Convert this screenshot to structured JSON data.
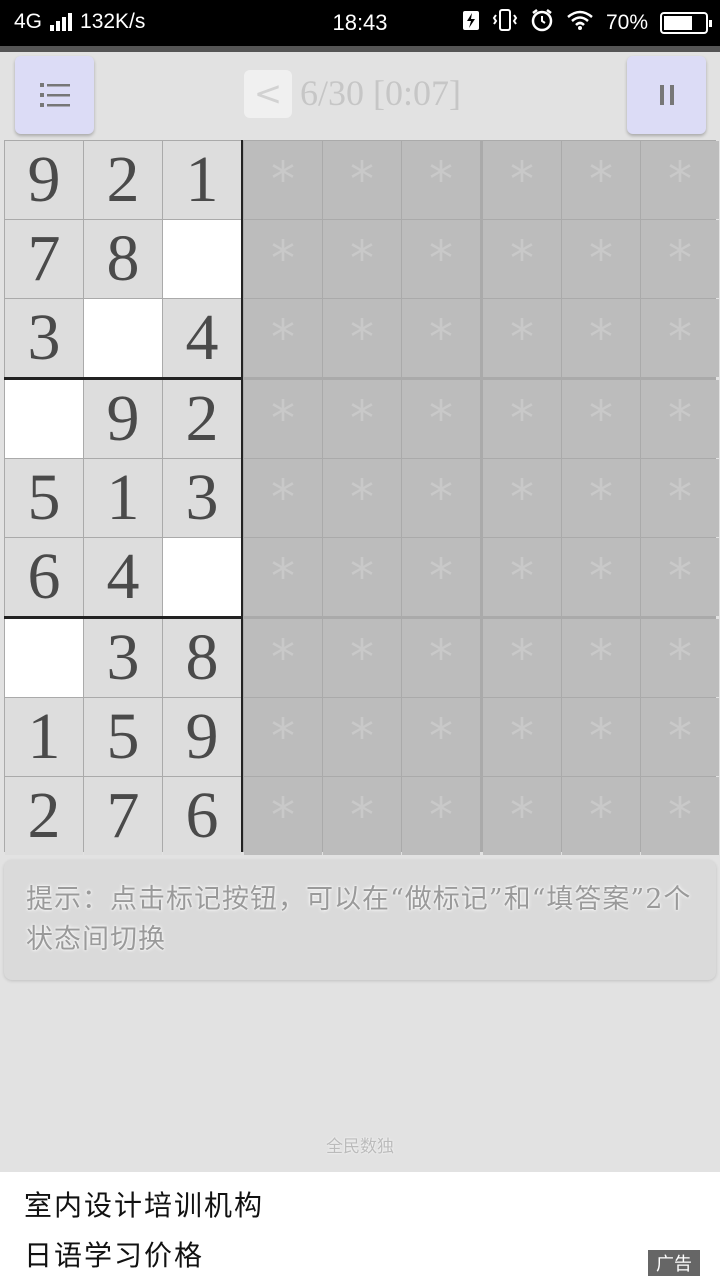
{
  "status_bar": {
    "network": "4G",
    "speed": "132K/s",
    "time": "18:43",
    "battery": "70%",
    "battery_level": 0.7,
    "icons": [
      "charging-icon",
      "vibrate-icon",
      "alarm-icon",
      "wifi-icon"
    ]
  },
  "toolbar": {
    "menu_icon": "list-icon",
    "back_label": "<",
    "progress": "6/30 [0:07]",
    "pause_icon": "pause-icon"
  },
  "board": {
    "revealed": [
      [
        "9",
        "2",
        "1"
      ],
      [
        "7",
        "8",
        ""
      ],
      [
        "3",
        "",
        "4"
      ],
      [
        "",
        "9",
        "2"
      ],
      [
        "5",
        "1",
        "3"
      ],
      [
        "6",
        "4",
        ""
      ],
      [
        "",
        "3",
        "8"
      ],
      [
        "1",
        "5",
        "9"
      ],
      [
        "2",
        "7",
        "6"
      ]
    ],
    "hidden_symbol": "*"
  },
  "tip": {
    "text": "提示：点击标记按钮，可以在“做标记”和“填答案”2个状态间切换"
  },
  "footer": {
    "app_name": "全民数独"
  },
  "ad": {
    "line1": "室内设计培训机构",
    "line2": "日语学习价格",
    "badge": "广告"
  }
}
